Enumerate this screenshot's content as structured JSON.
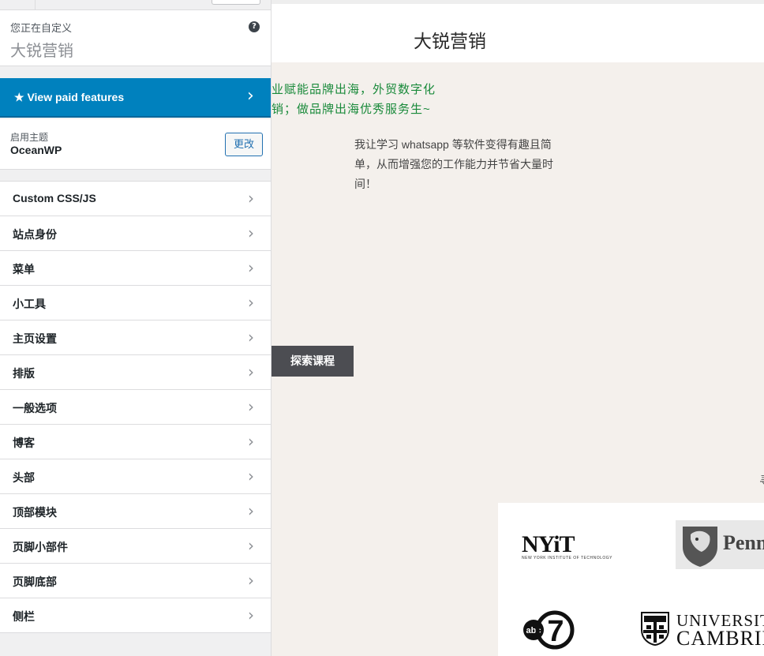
{
  "sidebar": {
    "customizing_label": "您正在自定义",
    "site_name": "大锐营销",
    "help_icon": "?",
    "paid_features": "★ View paid features",
    "active_theme_label": "启用主题",
    "theme_name": "OceanWP",
    "change_button": "更改",
    "chevron": "›",
    "items": [
      {
        "label": "Custom CSS/JS"
      },
      {
        "label": "站点身份"
      },
      {
        "label": "菜单"
      },
      {
        "label": "小工具"
      },
      {
        "label": "主页设置"
      },
      {
        "label": "排版"
      },
      {
        "label": "一般选项"
      },
      {
        "label": "博客"
      },
      {
        "label": "头部"
      },
      {
        "label": "顶部模块"
      },
      {
        "label": "页脚小部件"
      },
      {
        "label": "页脚底部"
      },
      {
        "label": "侧栏"
      }
    ]
  },
  "preview": {
    "site_title": "大锐营销",
    "hero_line_1": "业赋能品牌出海，外贸数字化",
    "hero_line_2": "销；做品牌出海优秀服务生~",
    "body_text": "我让学习 whatsapp 等软件变得有趣且简单，从而增强您的工作能力并节省大量时间！",
    "explore_button": "探索课程",
    "edge_char": "寻",
    "logos": {
      "nyit_big": "NYiT",
      "nyit_small": "NEW YORK INSTITUTE OF TECHNOLOGY",
      "penn": "Penn",
      "abc_text": "abc",
      "abc_number": "7",
      "cambridge_1": "UNIVERSITY",
      "cambridge_2": "CAMBRIDGE"
    }
  },
  "colors": {
    "accent": "#0081be",
    "green_text": "#1a8a3b",
    "button_dark": "#4c4d52"
  }
}
